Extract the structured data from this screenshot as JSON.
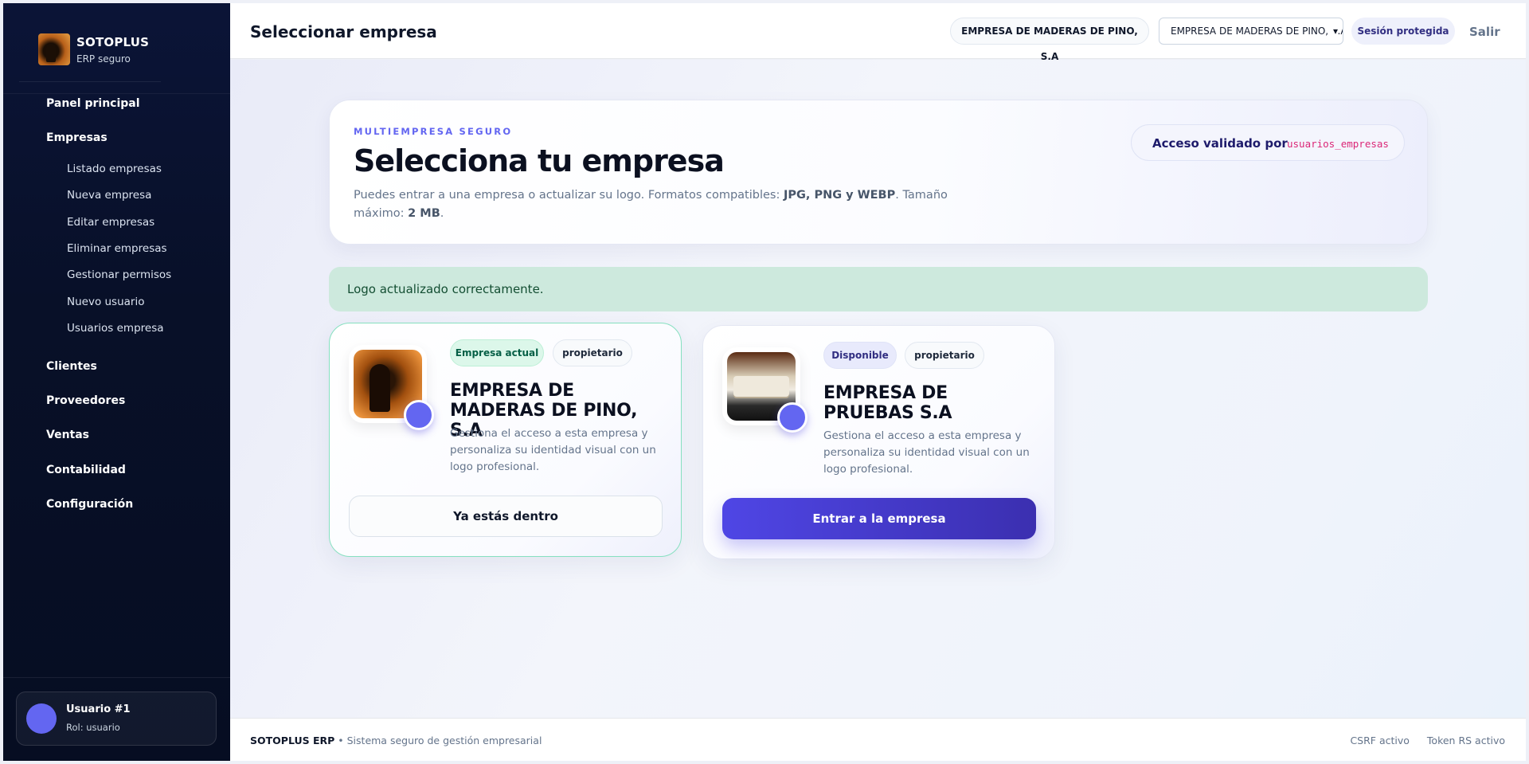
{
  "sidebar": {
    "brand_name": "SOTOPLUS",
    "brand_sub": "ERP seguro",
    "items": [
      {
        "label": "Panel principal"
      },
      {
        "label": "Empresas"
      },
      {
        "label": "Clientes"
      },
      {
        "label": "Proveedores"
      },
      {
        "label": "Ventas"
      },
      {
        "label": "Contabilidad"
      },
      {
        "label": "Configuración"
      }
    ],
    "empresas_sub": [
      {
        "label": "Listado empresas"
      },
      {
        "label": "Nueva empresa"
      },
      {
        "label": "Editar empresas"
      },
      {
        "label": "Eliminar empresas"
      },
      {
        "label": "Gestionar permisos"
      },
      {
        "label": "Nuevo usuario"
      },
      {
        "label": "Usuarios empresa"
      }
    ],
    "user": {
      "name": "Usuario #1",
      "role": "Rol: usuario"
    }
  },
  "topbar": {
    "title": "Seleccionar empresa",
    "current_company": "EMPRESA DE MADERAS DE PINO, S.A",
    "select_value": "EMPRESA DE MADERAS DE PINO, S.A",
    "secure_label": "Sesión protegida",
    "logout_label": "Salir"
  },
  "hero": {
    "eyebrow": "MULTIEMPRESA SEGURO",
    "title": "Selecciona tu empresa",
    "text_before": "Puedes entrar a una empresa o actualizar su logo. Formatos compatibles: ",
    "formats": "JPG, PNG y WEBP",
    "text_middle": ". Tamaño máximo: ",
    "max_size": "2 MB",
    "text_end": ".",
    "access_label": "Acceso validado por",
    "access_code": "usuarios_empresas"
  },
  "alert": {
    "message": "Logo actualizado correctamente."
  },
  "cards": [
    {
      "status": "Empresa actual",
      "role": "propietario",
      "name": "EMPRESA DE MADERAS DE PINO, S.A",
      "description": "Gestiona el acceso a esta empresa y personaliza su identidad visual con un logo profesional.",
      "action": "Ya estás dentro",
      "status_color": "#065f46"
    },
    {
      "status": "Disponible",
      "role": "propietario",
      "name": "EMPRESA DE PRUEBAS S.A",
      "description": "Gestiona el acceso a esta empresa y personaliza su identidad visual con un logo profesional.",
      "action": "Entrar a la empresa",
      "status_color": "#312e81"
    }
  ],
  "footer": {
    "brand": "SOTOPLUS ERP",
    "tagline": " • Sistema seguro de gestión empresarial",
    "csrf": "CSRF activo",
    "token": "Token RS activo"
  },
  "colors": {
    "accent": "#6366f1",
    "sidebar_bg": "#081028",
    "success_bg": "#cde9dd",
    "code": "#db2777"
  }
}
